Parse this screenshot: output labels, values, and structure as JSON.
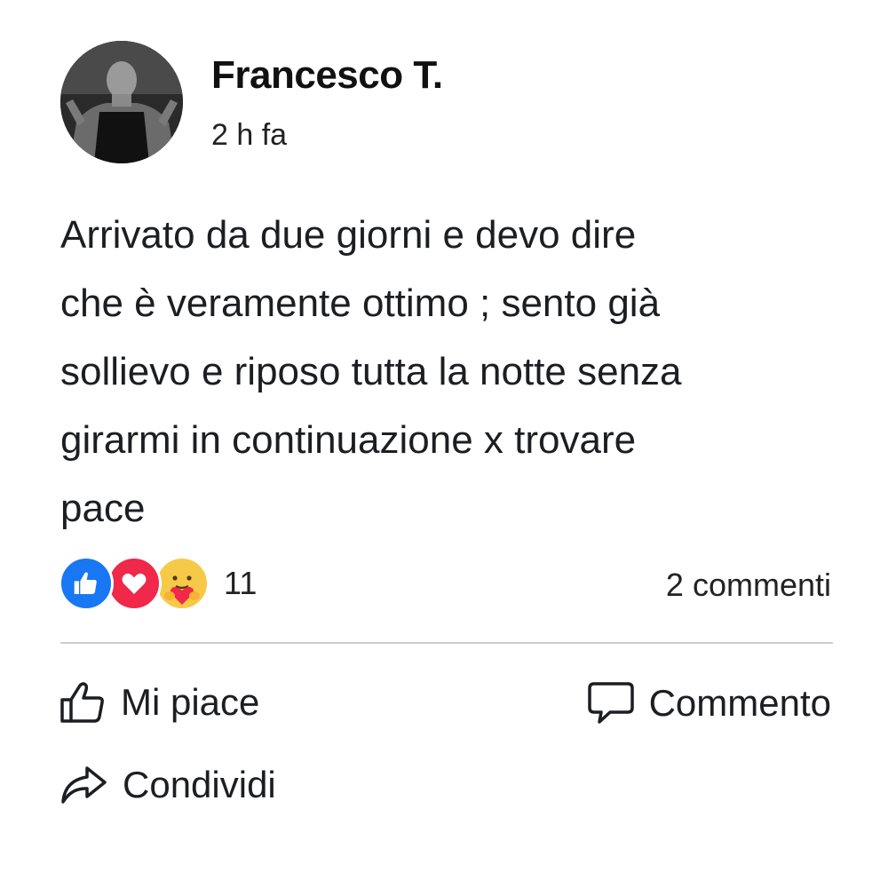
{
  "post": {
    "author": "Francesco T.",
    "timestamp": "2 h fa",
    "text": "Arrivato da due giorni e devo dire\nche è veramente ottimo ; sento già\nsollievo e riposo tutta la notte senza\ngirarmi in continuazione x trovare\npace",
    "reactions": {
      "icons": [
        "like-icon",
        "love-icon",
        "care-icon"
      ],
      "count": "11"
    },
    "comments_count": "2 commenti"
  },
  "actions": {
    "like_label": "Mi piace",
    "comment_label": "Commento",
    "share_label": "Condividi"
  },
  "colors": {
    "like": "#1877f2",
    "love": "#f0284a",
    "care": "#f7c948",
    "divider": "#c8cfdc"
  }
}
